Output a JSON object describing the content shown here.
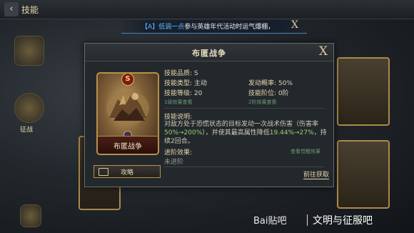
{
  "topbar": {
    "back_glyph": "‹",
    "title": "技能"
  },
  "banner": {
    "prefix": "【A】",
    "highlight": "低调一点",
    "text": "参与英雄年代活动时运气爆棚，",
    "close_glyph": "X"
  },
  "side": {
    "left_label": "征战"
  },
  "dialog": {
    "title": "布匿战争",
    "close_glyph": "X",
    "card": {
      "grade": "S",
      "name": "布匿战争"
    },
    "guide_label": "攻略",
    "quality_label": "技能品质:",
    "quality_value": "S",
    "type_label": "技能类型:",
    "type_value": "主动",
    "level_label": "技能等级:",
    "level_value": "20",
    "level_link": "1级效果查看",
    "chance_label": "发动概率:",
    "chance_value": "50%",
    "stage_label": "技能阶位:",
    "stage_value": "0阶",
    "stage_link": "2阶效果查看",
    "desc_label": "技能说明:",
    "desc_1": "对敌方处于恐慌状态的目标发动一次战术伤害（伤害率",
    "desc_g1": "50%→200%",
    "desc_2": "），并使其最高属性降低",
    "desc_g2": "19.44%→27%",
    "desc_3": "，持续2回合。",
    "adv_label": "进阶效果:",
    "adv_value": "未进阶",
    "adv_link": "查看觉醒效果",
    "obtain_label": "前往获取"
  },
  "watermark": {
    "brand": "Bai贴吧",
    "name": "文明与征服吧"
  }
}
